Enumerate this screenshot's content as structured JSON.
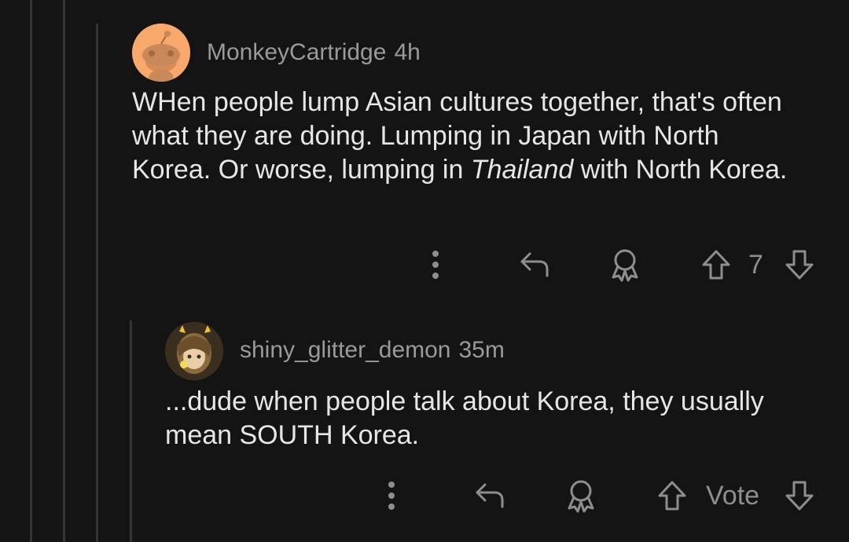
{
  "comments": [
    {
      "username": "MonkeyCartridge",
      "time": "4h",
      "body_parts": [
        "WHen people lump Asian cultures together, that's often what they are doing. Lumping in Japan with North Korea. Or worse, lumping in ",
        "Thailand",
        " with North Korea."
      ],
      "vote_label": "7",
      "avatar_color": "#f7a86a"
    },
    {
      "username": "shiny_glitter_demon",
      "time": "35m",
      "body": "...dude when people talk about Korea, they usually mean SOUTH Korea.",
      "vote_label": "Vote",
      "avatar_color": "#5a4a2a"
    }
  ],
  "icons": {
    "more": "more-options-icon",
    "reply": "reply-icon",
    "award": "award-icon",
    "upvote": "upvote-arrow-icon",
    "downvote": "downvote-arrow-icon"
  }
}
